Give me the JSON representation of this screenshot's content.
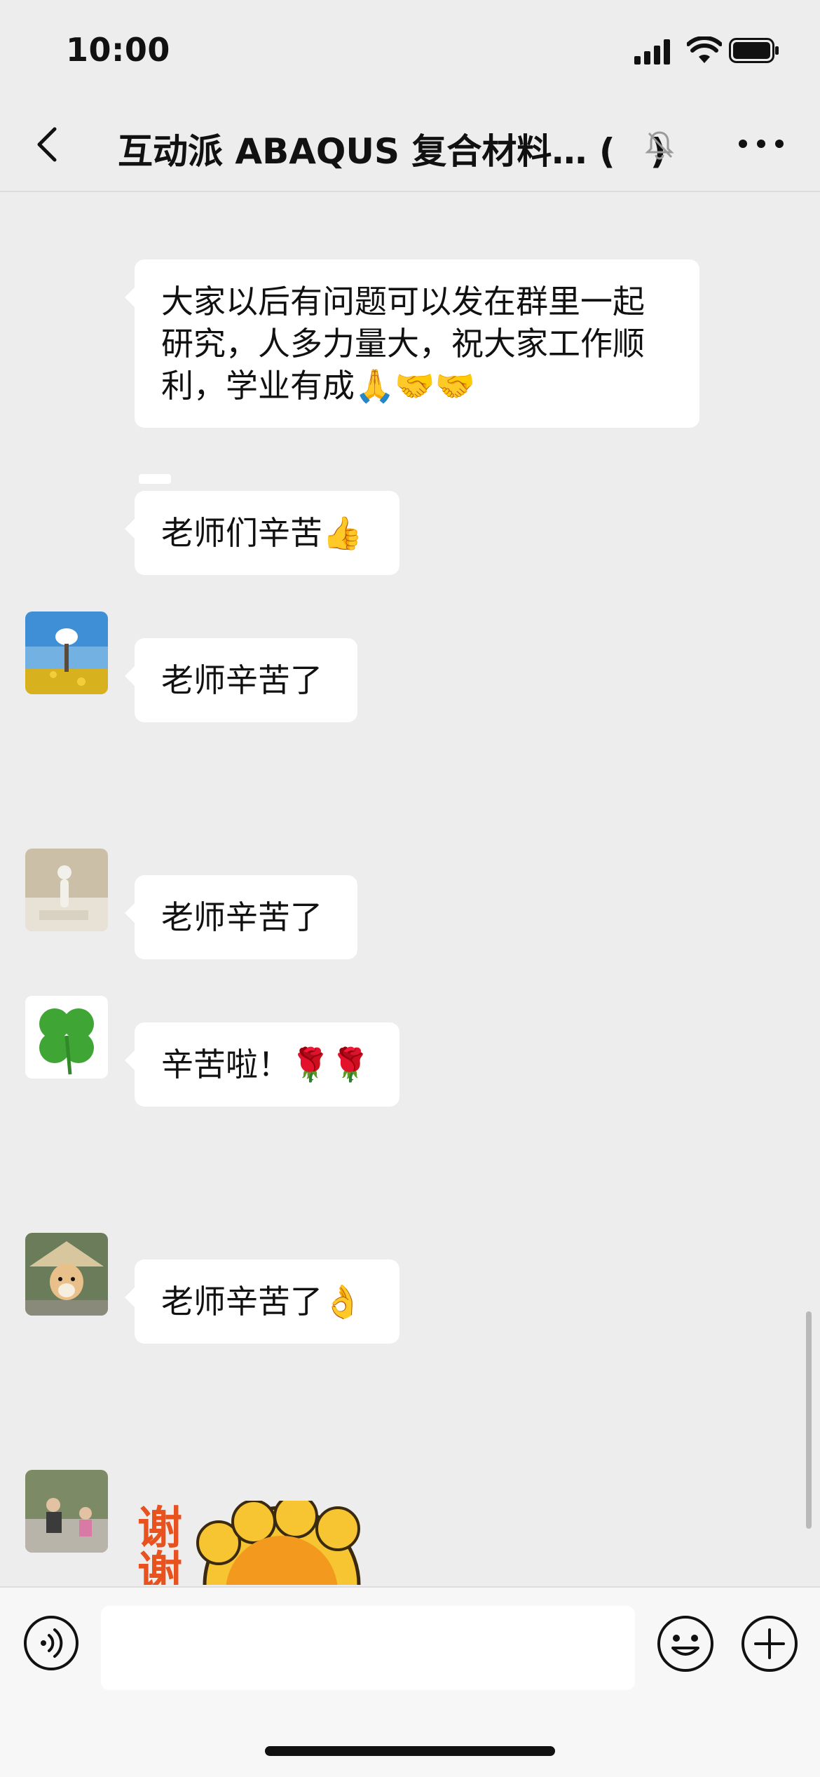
{
  "status_bar": {
    "time": "10:00"
  },
  "header": {
    "title": "互动派 ABAQUS 复合材料… (　)"
  },
  "messages": [
    {
      "text": "大家以后有问题可以发在群里一起研究，人多力量大，祝大家工作顺利，学业有成🙏🤝🤝"
    },
    {
      "text": "老师们辛苦👍"
    },
    {
      "text": "老师辛苦了"
    },
    {
      "text": "老师辛苦了"
    },
    {
      "text": "辛苦啦！🌹🌹"
    },
    {
      "text": "老师辛苦了👌"
    }
  ],
  "sticker": {
    "text": "谢谢"
  },
  "avatars": {
    "a1": "field-photo-avatar",
    "a2": "figure-photo-avatar",
    "a3": "clover-avatar",
    "a4": "dog-hat-avatar",
    "a5": "people-photo-avatar"
  },
  "colors": {
    "background": "#ededed",
    "bubble": "#ffffff",
    "input_bar": "#f7f7f7"
  }
}
